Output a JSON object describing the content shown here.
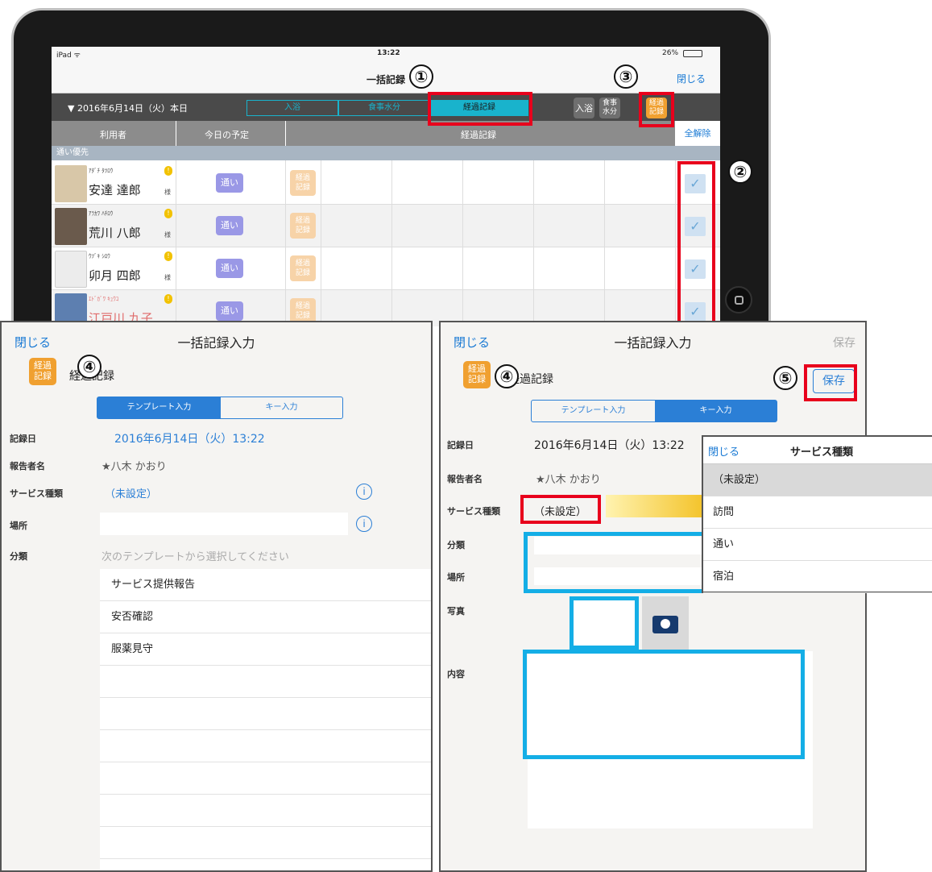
{
  "top_screen": {
    "status": {
      "device": "iPad ᯤ",
      "time": "13:22",
      "battery": "26%"
    },
    "nav": {
      "title": "一括記録",
      "close": "閉じる"
    },
    "date": "▼ 2016年6月14日（火）本日",
    "tabs": [
      "入浴",
      "食事水分",
      "経過記録"
    ],
    "icon_buttons": [
      "入浴",
      "食事\n水分",
      "経過\n記録"
    ],
    "headers": {
      "user": "利用者",
      "plan": "今日の予定",
      "record": "経過記録",
      "clear_all": "全解除"
    },
    "group": "通い優先",
    "users": [
      {
        "kana": "ｱﾀﾞﾁ ﾀﾂﾛｳ",
        "name": "安達 達郎",
        "plan": "通い",
        "record": "経過\n記録"
      },
      {
        "kana": "ｱﾗｶﾜ ﾊﾁﾛｳ",
        "name": "荒川 八郎",
        "plan": "通い",
        "record": "経過\n記録"
      },
      {
        "kana": "ｳﾂﾞｷ ｼﾛｳ",
        "name": "卯月 四郎",
        "plan": "通い",
        "record": "経過\n記録"
      },
      {
        "kana": "ｴﾄﾞｶﾞﾜ ｷｭｳｺ",
        "name": "江戸川 九子",
        "plan": "通い",
        "record": "経過\n記録"
      }
    ],
    "sama": "様",
    "check": "✓",
    "warn": "!"
  },
  "annotations": [
    "①",
    "②",
    "③",
    "④",
    "④",
    "⑤"
  ],
  "left_panel": {
    "close": "閉じる",
    "title": "一括記録入力",
    "badge": "経過\n記録",
    "record_type": "経過記録",
    "seg": [
      "テンプレート入力",
      "キー入力"
    ],
    "labels": {
      "date": "記録日",
      "reporter": "報告者名",
      "service": "サービス種類",
      "place": "場所",
      "category": "分類"
    },
    "values": {
      "date": "2016年6月14日（火）13:22",
      "reporter": "★八木 かおり",
      "service": "（未設定）",
      "category_hint": "次のテンプレートから選択してください"
    },
    "templates": [
      "サービス提供報告",
      "安否確認",
      "服薬見守"
    ]
  },
  "right_panel": {
    "close": "閉じる",
    "title": "一括記録入力",
    "save_top": "保存",
    "save_button": "保存",
    "badge": "経過\n記録",
    "record_type": "経過記録",
    "seg": [
      "テンプレート入力",
      "キー入力"
    ],
    "labels": {
      "date": "記録日",
      "reporter": "報告者名",
      "service": "サービス種類",
      "category": "分類",
      "place": "場所",
      "photo": "写真",
      "content": "内容"
    },
    "values": {
      "date": "2016年6月14日（火）13:22",
      "reporter": "★八木 かおり",
      "service": "（未設定）"
    }
  },
  "popover": {
    "close": "閉じる",
    "title": "サービス種類",
    "items": [
      "（未設定）",
      "訪問",
      "通い",
      "宿泊"
    ]
  },
  "colors": {
    "accent_blue": "#1a7ad4",
    "teal": "#19b3cc",
    "highlight_red": "#e8001c",
    "highlight_blue": "#14aee6",
    "orange": "#f0a030"
  }
}
